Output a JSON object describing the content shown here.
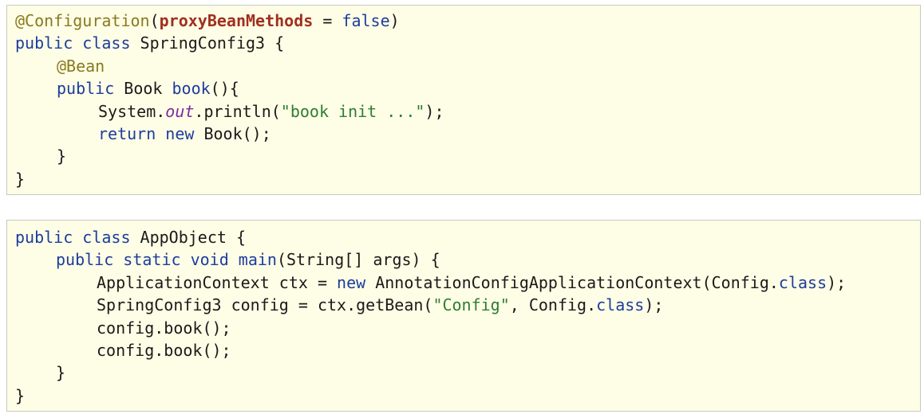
{
  "colors": {
    "background": "#fefde6",
    "border": "#c9c9c0",
    "keyword": "#1c3d9c",
    "annotation": "#8a7a1e",
    "param": "#a0301e",
    "string": "#2e7d32",
    "field": "#7b2c9e",
    "text": "#1a1a1a"
  },
  "blocks": [
    {
      "lines": [
        {
          "indent": 0,
          "tokens": [
            {
              "t": "@Configuration",
              "k": "ann"
            },
            {
              "t": "(",
              "k": "plain"
            },
            {
              "t": "proxyBeanMethods",
              "k": "param"
            },
            {
              "t": " = ",
              "k": "plain"
            },
            {
              "t": "false",
              "k": "bool"
            },
            {
              "t": ")",
              "k": "plain"
            }
          ]
        },
        {
          "indent": 0,
          "tokens": [
            {
              "t": "public class",
              "k": "kw"
            },
            {
              "t": " SpringConfig3 {",
              "k": "plain"
            }
          ]
        },
        {
          "indent": 1,
          "tokens": [
            {
              "t": "@Bean",
              "k": "ann"
            }
          ]
        },
        {
          "indent": 1,
          "tokens": [
            {
              "t": "public",
              "k": "kw"
            },
            {
              "t": " Book ",
              "k": "plain"
            },
            {
              "t": "book",
              "k": "kw"
            },
            {
              "t": "(){",
              "k": "plain"
            }
          ]
        },
        {
          "indent": 2,
          "tokens": [
            {
              "t": "System.",
              "k": "plain"
            },
            {
              "t": "out",
              "k": "field"
            },
            {
              "t": ".println(",
              "k": "plain"
            },
            {
              "t": "\"book init ...\"",
              "k": "str"
            },
            {
              "t": ");",
              "k": "plain"
            }
          ]
        },
        {
          "indent": 2,
          "tokens": [
            {
              "t": "return new",
              "k": "kw"
            },
            {
              "t": " Book();",
              "k": "plain"
            }
          ]
        },
        {
          "indent": 1,
          "tokens": [
            {
              "t": "}",
              "k": "plain"
            }
          ]
        },
        {
          "indent": 0,
          "tokens": [
            {
              "t": "}",
              "k": "plain"
            }
          ]
        }
      ]
    },
    {
      "lines": [
        {
          "indent": 0,
          "tokens": [
            {
              "t": "public class",
              "k": "kw"
            },
            {
              "t": " AppObject {",
              "k": "plain"
            }
          ]
        },
        {
          "indent": 1,
          "tokens": [
            {
              "t": "public static void",
              "k": "kw"
            },
            {
              "t": " ",
              "k": "plain"
            },
            {
              "t": "main",
              "k": "kw"
            },
            {
              "t": "(String[] args) {",
              "k": "plain"
            }
          ]
        },
        {
          "indent": 2,
          "tokens": [
            {
              "t": "ApplicationContext ctx = ",
              "k": "plain"
            },
            {
              "t": "new",
              "k": "kw"
            },
            {
              "t": " AnnotationConfigApplicationContext(Config.",
              "k": "plain"
            },
            {
              "t": "class",
              "k": "kw"
            },
            {
              "t": ");",
              "k": "plain"
            }
          ]
        },
        {
          "indent": 2,
          "tokens": [
            {
              "t": "SpringConfig3 config = ctx.getBean(",
              "k": "plain"
            },
            {
              "t": "\"Config\"",
              "k": "str"
            },
            {
              "t": ", Config.",
              "k": "plain"
            },
            {
              "t": "class",
              "k": "kw"
            },
            {
              "t": ");",
              "k": "plain"
            }
          ]
        },
        {
          "indent": 2,
          "tokens": [
            {
              "t": "config.book();",
              "k": "plain"
            }
          ]
        },
        {
          "indent": 2,
          "tokens": [
            {
              "t": "config.book();",
              "k": "plain"
            }
          ]
        },
        {
          "indent": 1,
          "tokens": [
            {
              "t": "}",
              "k": "plain"
            }
          ]
        },
        {
          "indent": 0,
          "tokens": [
            {
              "t": "}",
              "k": "plain"
            }
          ]
        }
      ]
    }
  ]
}
